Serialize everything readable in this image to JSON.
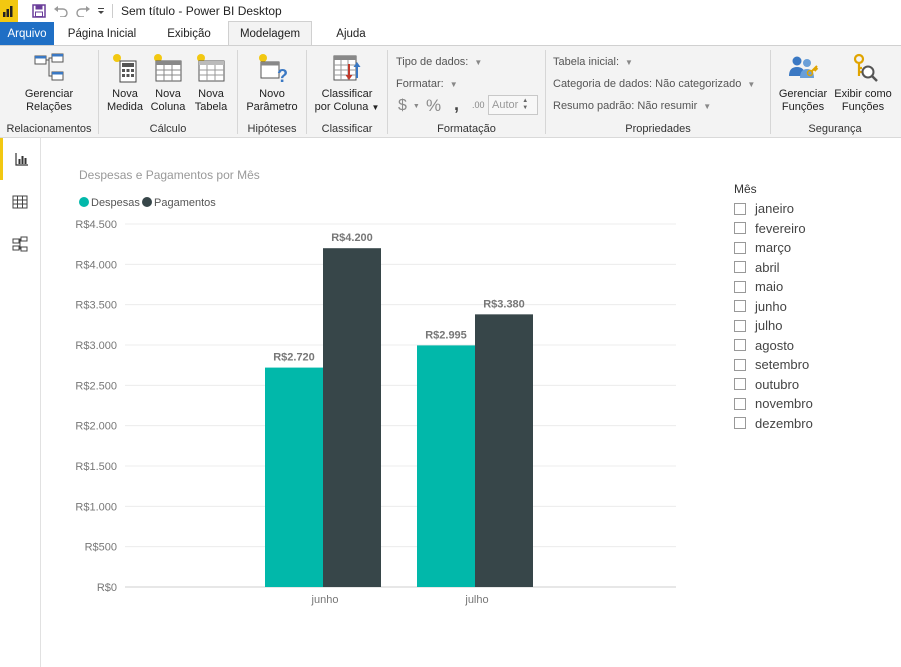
{
  "titlebar": {
    "title": "Sem título - Power BI Desktop"
  },
  "tabs": [
    "Arquivo",
    "Página Inicial",
    "Exibição",
    "Modelagem",
    "Ajuda"
  ],
  "ribbon": {
    "groups": {
      "relacionamentos": {
        "label": "Relacionamentos",
        "btn": [
          "Gerenciar",
          "Relações"
        ]
      },
      "calculo": {
        "label": "Cálculo",
        "btns": [
          [
            "Nova",
            "Medida"
          ],
          [
            "Nova",
            "Coluna"
          ],
          [
            "Nova",
            "Tabela"
          ]
        ]
      },
      "hipoteses": {
        "label": "Hipóteses",
        "btn": [
          "Novo",
          "Parâmetro"
        ]
      },
      "classificar": {
        "label": "Classificar",
        "btn": [
          "Classificar",
          "por Coluna"
        ]
      },
      "formatacao": {
        "label": "Formatação",
        "tipo": "Tipo de dados:",
        "formatar": "Formatar:",
        "currency": "$",
        "percent": "%",
        "comma": ",",
        "decimals": ".00",
        "auto": "Autor"
      },
      "propriedades": {
        "label": "Propriedades",
        "tabela": "Tabela inicial:",
        "categoria": "Categoria de dados: Não categorizado",
        "resumo": "Resumo padrão: Não resumir"
      },
      "seguranca": {
        "label": "Segurança",
        "btns": [
          [
            "Gerenciar",
            "Funções"
          ],
          [
            "Exibir como",
            "Funções"
          ]
        ]
      }
    }
  },
  "colors": {
    "despesas": "#01b8aa",
    "pagamentos": "#374649",
    "accent": "#f2c811",
    "file_tab": "#1f6fc5"
  },
  "chart_data": {
    "type": "bar",
    "title": "Despesas e Pagamentos por Mês",
    "categories": [
      "junho",
      "julho"
    ],
    "series": [
      {
        "name": "Despesas",
        "values": [
          2720,
          2995
        ],
        "labels": [
          "R$2.720",
          "R$2.995"
        ]
      },
      {
        "name": "Pagamentos",
        "values": [
          4200,
          3380
        ],
        "labels": [
          "R$4.200",
          "R$3.380"
        ]
      }
    ],
    "ylim": [
      0,
      4500
    ],
    "yticks": [
      "R$0",
      "R$500",
      "R$1.000",
      "R$1.500",
      "R$2.000",
      "R$2.500",
      "R$3.000",
      "R$3.500",
      "R$4.000",
      "R$4.500"
    ],
    "legend": "top-left",
    "grid": true
  },
  "slicer": {
    "title": "Mês",
    "items": [
      "janeiro",
      "fevereiro",
      "março",
      "abril",
      "maio",
      "junho",
      "julho",
      "agosto",
      "setembro",
      "outubro",
      "novembro",
      "dezembro"
    ]
  }
}
